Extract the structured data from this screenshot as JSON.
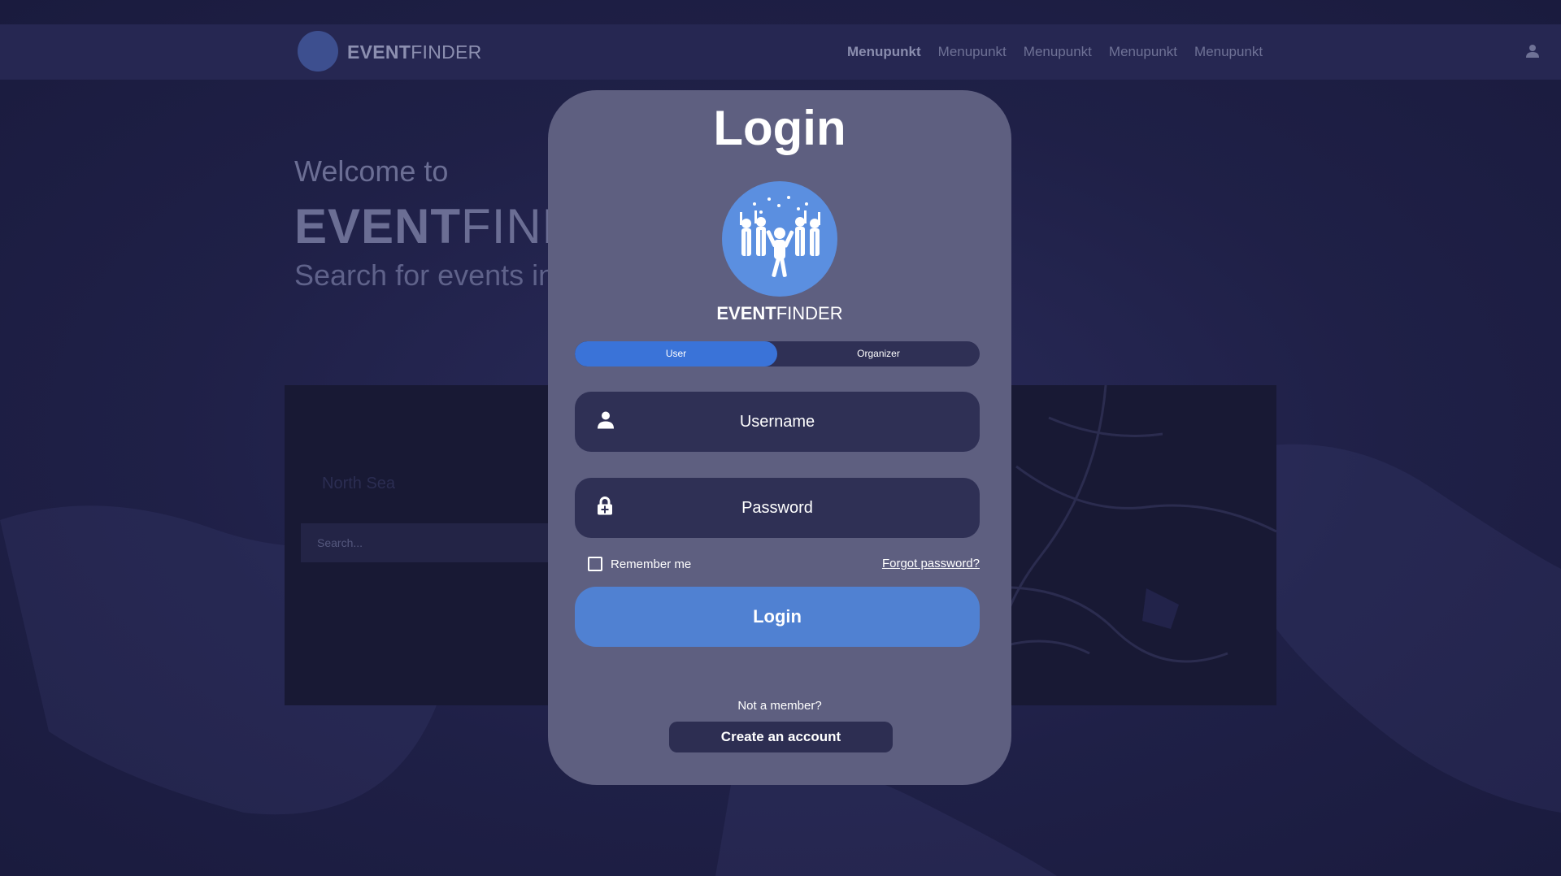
{
  "navbar": {
    "logo_icon": "party-crowd-logo",
    "brand_bold": "EVENT",
    "brand_light": "FINDER",
    "links": [
      "Menupunkt",
      "Menupunkt",
      "Menupunkt",
      "Menupunkt",
      "Menupunkt"
    ],
    "user_icon": "user-icon"
  },
  "hero": {
    "welcome": "Welcome to",
    "brand_bold": "EVENT",
    "brand_light": "FINDI",
    "subtitle": "Search for events in y"
  },
  "map": {
    "label": "North Sea",
    "search_placeholder": "Search..."
  },
  "login_modal": {
    "title": "Login",
    "brand_bold": "EVENT",
    "brand_light": "FINDER",
    "roles": [
      "User",
      "Organizer"
    ],
    "active_role": "User",
    "username_placeholder": "Username",
    "password_placeholder": "Password",
    "remember_label": "Remember me",
    "forgot_label": "Forgot password?",
    "login_button": "Login",
    "not_member": "Not a member?",
    "create_account": "Create an account"
  },
  "colors": {
    "background": "#1e1f44",
    "modal": "#5e5f80",
    "accent": "#3a73d8",
    "login_button": "#5081d2",
    "field": "#2f3055"
  }
}
